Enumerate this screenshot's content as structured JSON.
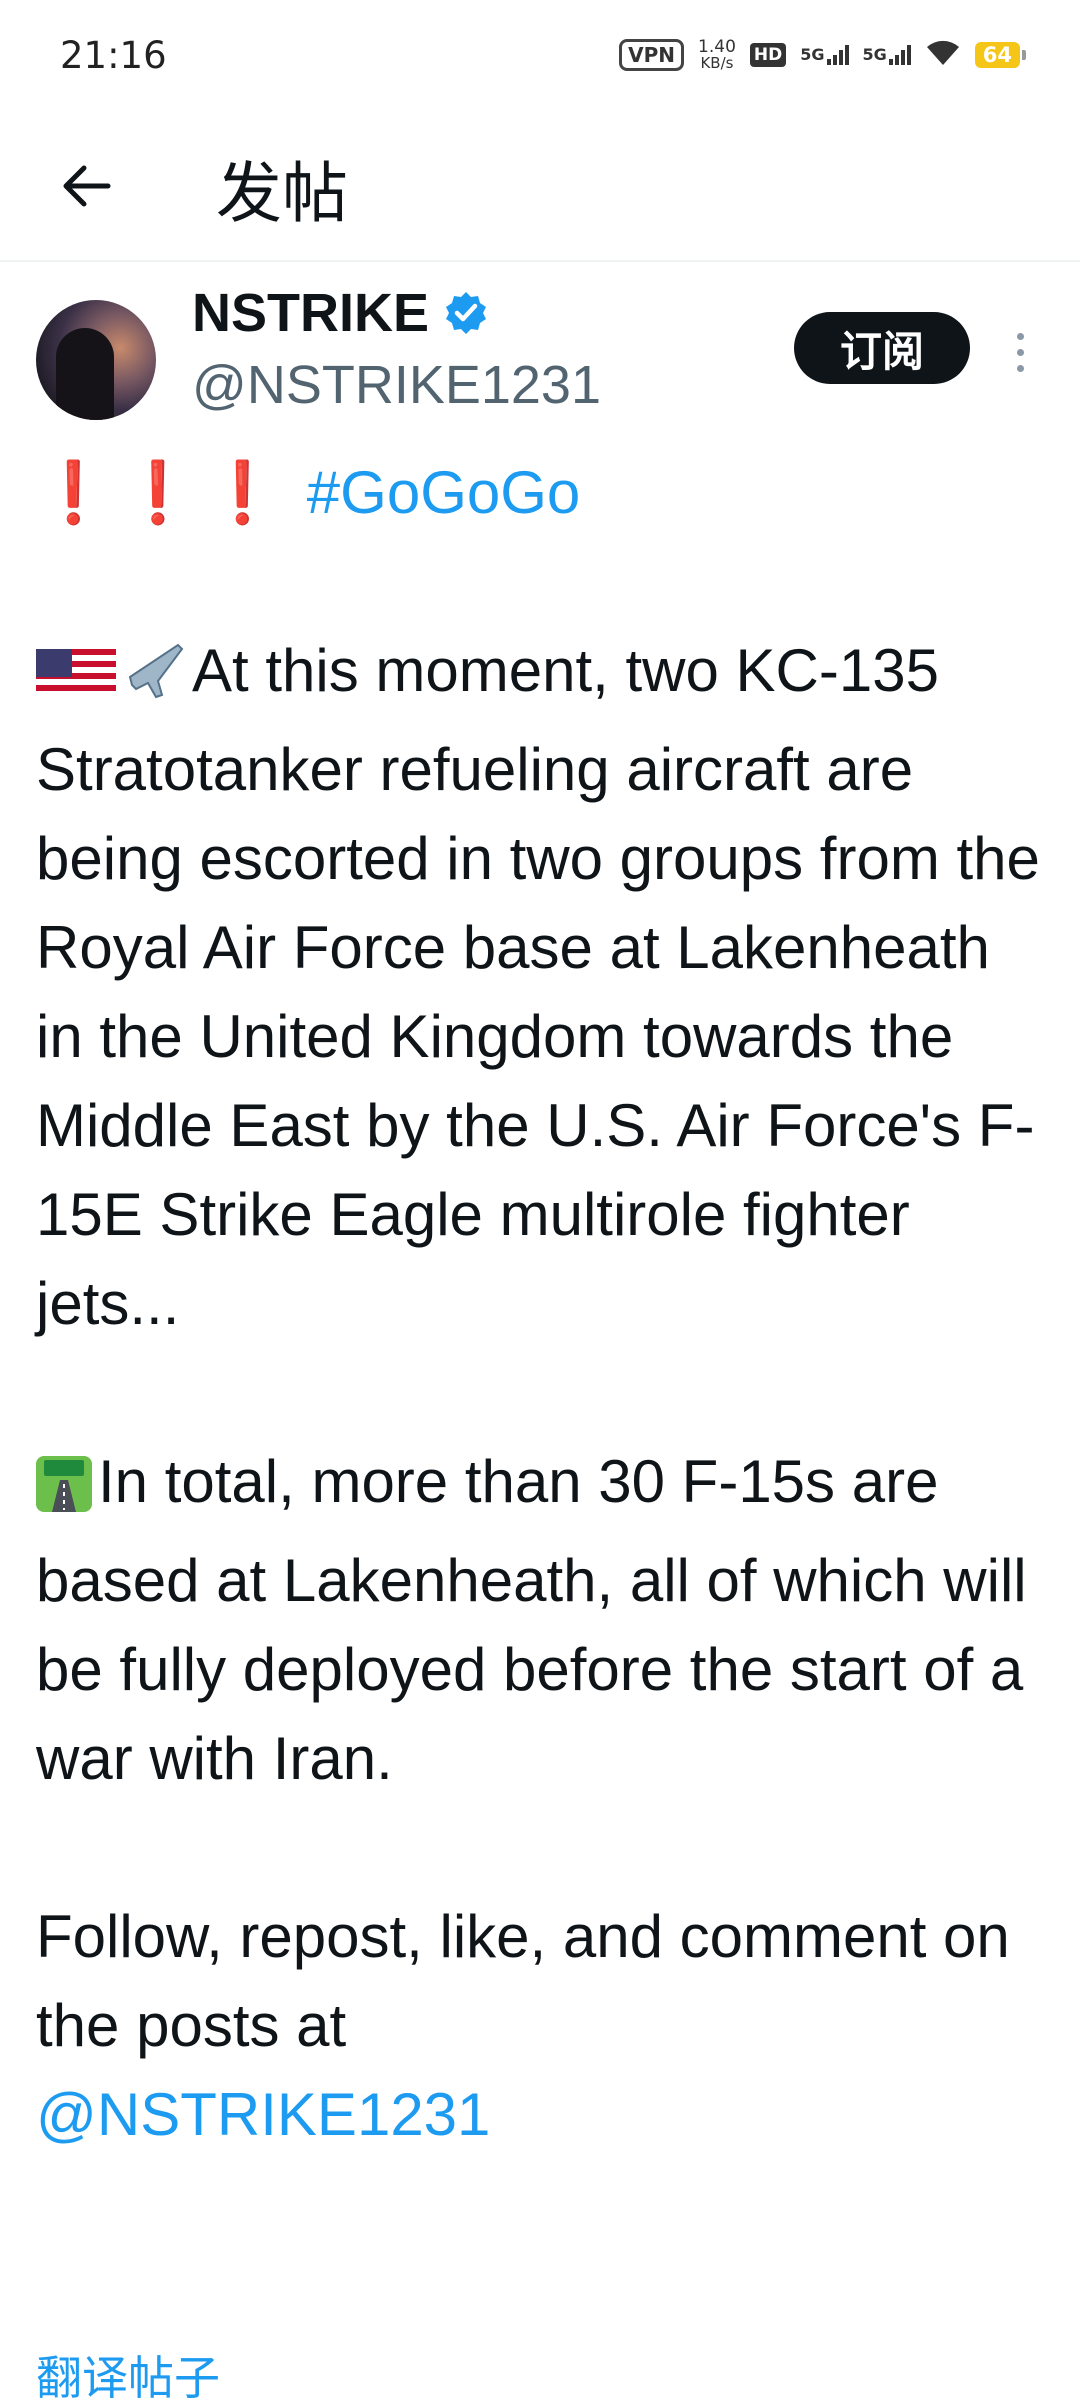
{
  "status_bar": {
    "time": "21:16",
    "vpn": "VPN",
    "speed_value": "1.40",
    "speed_unit": "KB/s",
    "hd": "HD",
    "net1": "5G",
    "net2": "5G",
    "battery": "64"
  },
  "nav": {
    "title": "发帖"
  },
  "post": {
    "display_name": "NSTRIKE",
    "handle": "@NSTRIKE1231",
    "subscribe_label": "订阅",
    "exclaim": "❗❗❗",
    "hashtag": "#GoGoGo",
    "paragraph1": "At this moment, two KC-135 Stratotanker refueling aircraft are being escorted in two groups from the Royal Air Force base at Lakenheath in the United Kingdom towards the Middle East by the U.S. Air Force's F-15E Strike Eagle multirole fighter jets...",
    "paragraph2": "In total, more than 30 F-15s are based at Lakenheath, all of which will be fully deployed before the start of a war with Iran.",
    "paragraph3": "Follow, repost, like, and comment on the posts at",
    "mention": "@NSTRIKE1231",
    "translate_label": "翻译帖子"
  },
  "colors": {
    "link": "#1d9bf0",
    "verified": "#1d9bf0",
    "battery": "#f5c518"
  }
}
